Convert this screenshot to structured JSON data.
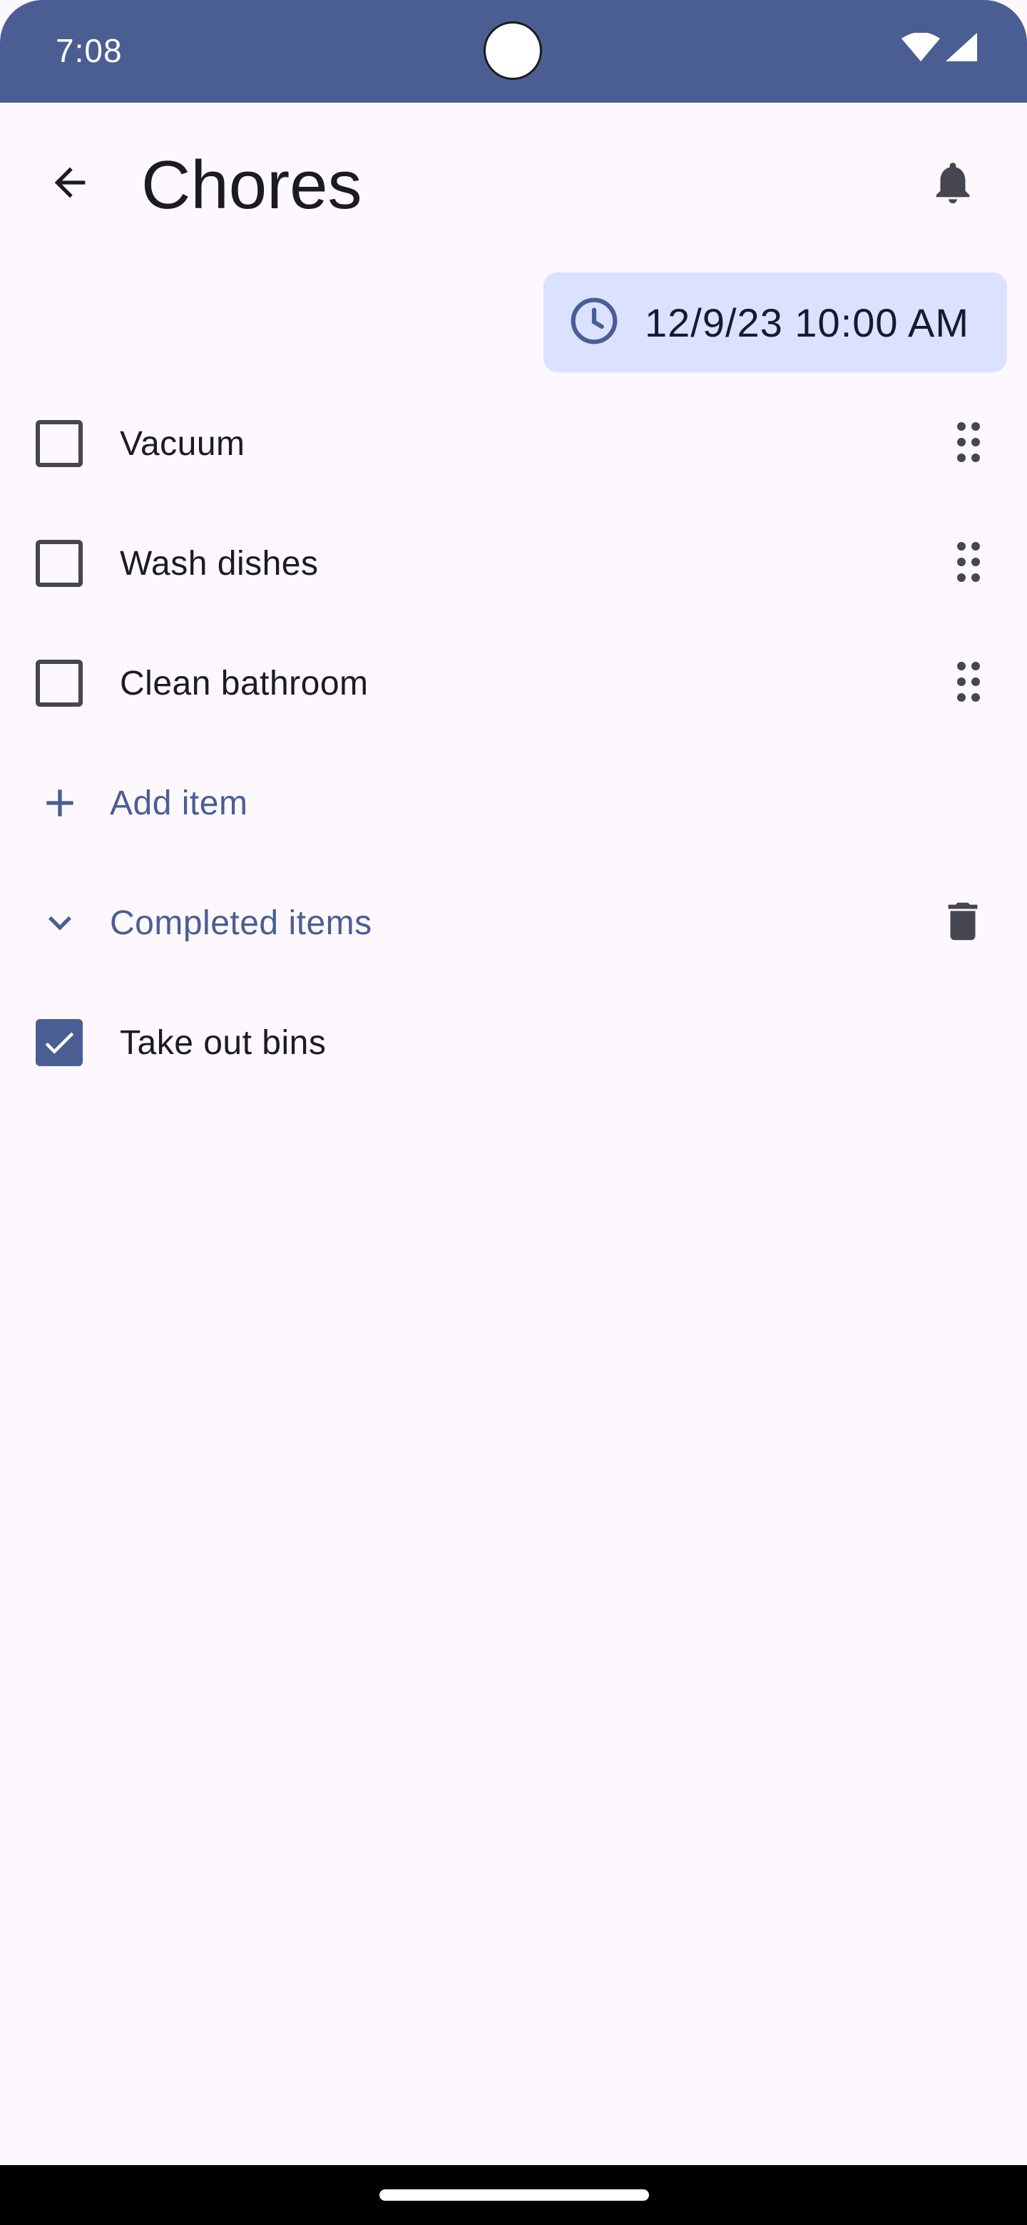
{
  "status_bar": {
    "time": "7:08",
    "icons": [
      "wifi-icon",
      "cellular-signal-icon"
    ],
    "background": "#4a5e94"
  },
  "app_bar": {
    "title": "Chores",
    "back_icon": "arrow-back-icon",
    "action_icon": "bell-icon"
  },
  "reminder": {
    "icon": "clock-icon",
    "label": "12/9/23 10:00 AM",
    "background": "#dae2ff"
  },
  "items": [
    {
      "label": "Vacuum",
      "checked": false
    },
    {
      "label": "Wash dishes",
      "checked": false
    },
    {
      "label": "Clean bathroom",
      "checked": false
    }
  ],
  "add_item": {
    "icon": "plus-icon",
    "label": "Add item"
  },
  "completed_section": {
    "icon": "chevron-down-icon",
    "label": "Completed items",
    "action_icon": "trash-icon",
    "items": [
      {
        "label": "Take out bins",
        "checked": true
      }
    ]
  },
  "colors": {
    "accent": "#4a5e94",
    "background": "#fcf8fd",
    "text": "#1b1b21"
  }
}
